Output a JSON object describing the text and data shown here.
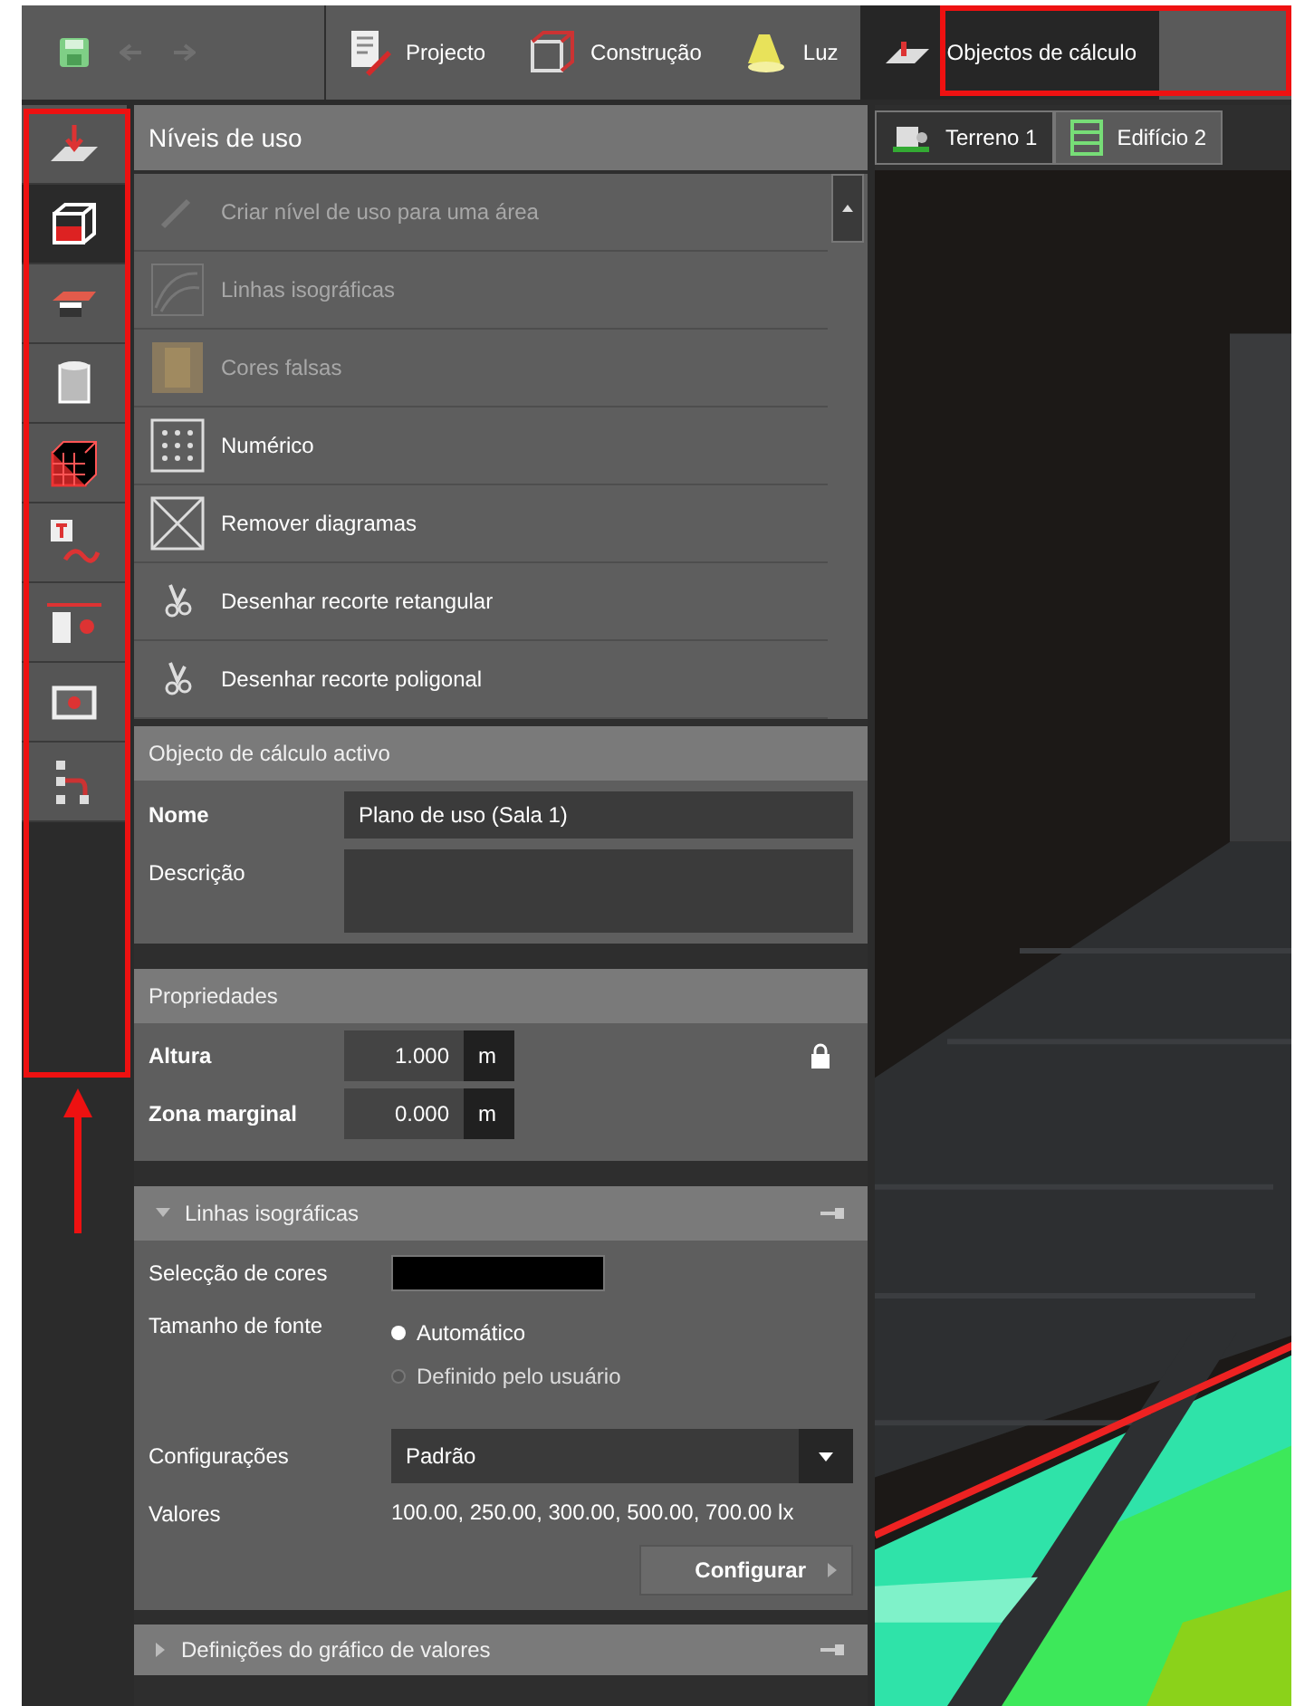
{
  "toolbar": {
    "tabs": [
      {
        "label": "Projecto",
        "selected": false
      },
      {
        "label": "Construção",
        "selected": false
      },
      {
        "label": "Luz",
        "selected": false
      },
      {
        "label": "Objectos de cálculo",
        "selected": true
      }
    ]
  },
  "side_tools": [
    {
      "selected": false
    },
    {
      "selected": true
    },
    {
      "selected": false
    },
    {
      "selected": false
    },
    {
      "selected": false
    },
    {
      "selected": false
    },
    {
      "selected": false
    },
    {
      "selected": false
    },
    {
      "selected": false
    }
  ],
  "panel": {
    "title": "Níveis de uso",
    "actions": [
      {
        "label": "Criar nível de uso para uma área",
        "disabled": true
      },
      {
        "label": "Linhas isográficas",
        "disabled": true
      },
      {
        "label": "Cores falsas",
        "disabled": true
      },
      {
        "label": "Numérico",
        "disabled": false
      },
      {
        "label": "Remover diagramas",
        "disabled": false
      },
      {
        "label": "Desenhar recorte retangular",
        "disabled": false
      },
      {
        "label": "Desenhar recorte poligonal",
        "disabled": false
      }
    ]
  },
  "active_object": {
    "title": "Objecto de cálculo activo",
    "name_label": "Nome",
    "name_value": "Plano de uso (Sala 1)",
    "description_label": "Descrição"
  },
  "properties": {
    "title": "Propriedades",
    "fields": [
      {
        "label": "Altura",
        "value": "1.000",
        "unit": "m"
      },
      {
        "label": "Zona marginal",
        "value": "0.000",
        "unit": "m"
      }
    ]
  },
  "isolines": {
    "title": "Linhas isográficas",
    "expanded": true,
    "color_label": "Selecção de cores",
    "font_size_label": "Tamanho de fonte",
    "font_size_options": [
      {
        "label": "Automático",
        "selected": true
      },
      {
        "label": "Definido pelo usuário",
        "selected": false
      }
    ],
    "config_label": "Configurações",
    "config_value": "Padrão",
    "values_label": "Valores",
    "values": "100.00, 250.00, 300.00, 500.00, 700.00 lx",
    "configure_button": "Configurar"
  },
  "value_chart_settings": {
    "title": "Definições do gráfico de valores",
    "expanded": false
  },
  "viewport": {
    "tabs": [
      {
        "label": "Terreno 1",
        "selected": false
      },
      {
        "label": "Edifício 2",
        "selected": true
      }
    ]
  }
}
